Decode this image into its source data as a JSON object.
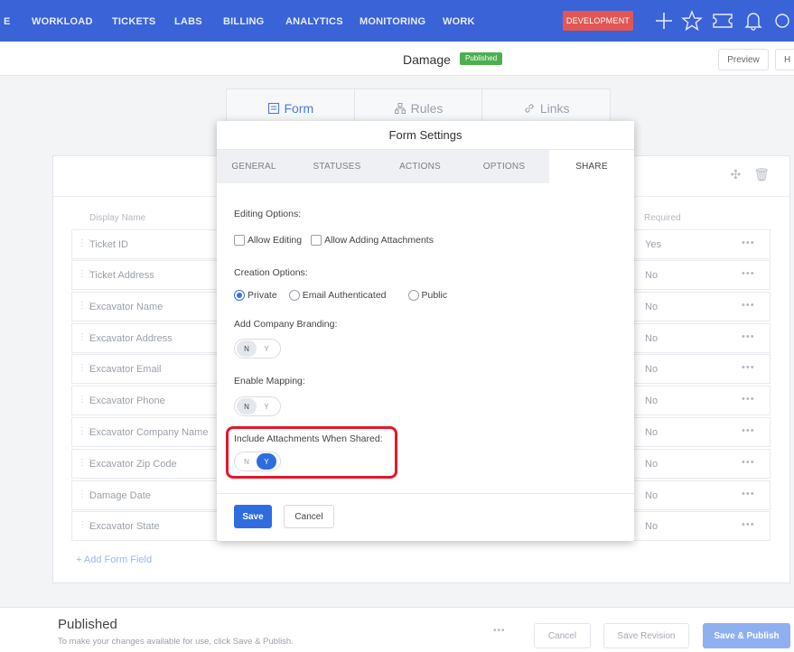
{
  "nav": {
    "items": [
      "E",
      "WORKLOAD",
      "TICKETS",
      "LABS",
      "BILLING",
      "ANALYTICS",
      "MONITORING",
      "WORK"
    ],
    "env_badge": "DEVELOPMENT"
  },
  "header": {
    "title": "Damage",
    "status_badge": "Published",
    "preview_label": "Preview",
    "help_label": "H"
  },
  "builder_tabs": [
    "Form",
    "Rules",
    "Links"
  ],
  "table": {
    "col_display_name": "Display Name",
    "col_required": "Required",
    "rows": [
      {
        "name": "Ticket ID",
        "required": "Yes"
      },
      {
        "name": "Ticket Address",
        "required": "No"
      },
      {
        "name": "Excavator Name",
        "required": "No"
      },
      {
        "name": "Excavator Address",
        "required": "No"
      },
      {
        "name": "Excavator Email",
        "required": "No"
      },
      {
        "name": "Excavator Phone",
        "required": "No"
      },
      {
        "name": "Excavator Company Name",
        "required": "No"
      },
      {
        "name": "Excavator Zip Code",
        "required": "No"
      },
      {
        "name": "Damage Date",
        "required": "No"
      },
      {
        "name": "Excavator State",
        "required": "No"
      }
    ],
    "more_glyph": "•••",
    "add_field_label": "+ Add Form Field"
  },
  "modal": {
    "title": "Form Settings",
    "tabs": [
      "GENERAL",
      "STATUSES",
      "ACTIONS",
      "OPTIONS",
      "SHARE"
    ],
    "active_tab": "SHARE",
    "editing_label": "Editing Options:",
    "allow_editing_label": "Allow Editing",
    "allow_attachments_label": "Allow Adding Attachments",
    "creation_label": "Creation Options:",
    "creation_options": [
      "Private",
      "Email Authenticated",
      "Public"
    ],
    "creation_selected": "Private",
    "branding_label": "Add Company Branding:",
    "branding_value": "N",
    "mapping_label": "Enable Mapping:",
    "mapping_value": "N",
    "attachments_shared_label": "Include Attachments When Shared:",
    "attachments_shared_value": "Y",
    "toggle_n": "N",
    "toggle_y": "Y",
    "save_label": "Save",
    "cancel_label": "Cancel"
  },
  "bottom": {
    "status": "Published",
    "hint": "To make your changes available for use, click Save & Publish.",
    "dots": "•••",
    "cancel_label": "Cancel",
    "save_revision_label": "Save Revision",
    "save_publish_label": "Save & Publish"
  },
  "colors": {
    "nav_bg": "#3a63d8",
    "primary": "#2f6ce0",
    "dev_badge": "#e25656",
    "published_badge": "#4caf50",
    "highlight": "#e5162b"
  }
}
